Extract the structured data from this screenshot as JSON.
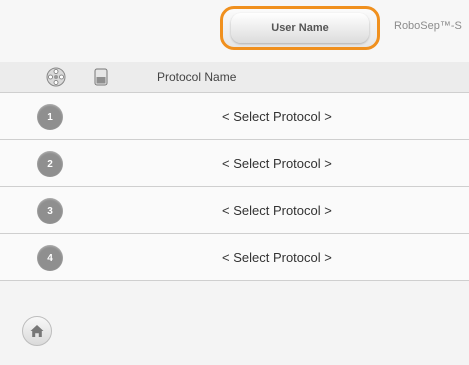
{
  "header": {
    "user_button_label": "User Name",
    "brand": "RoboSep™-S"
  },
  "table": {
    "column_title": "Protocol Name",
    "rows": [
      {
        "number": "1",
        "label": "< Select Protocol >"
      },
      {
        "number": "2",
        "label": "< Select Protocol >"
      },
      {
        "number": "3",
        "label": "< Select Protocol >"
      },
      {
        "number": "4",
        "label": "< Select Protocol >"
      }
    ]
  },
  "icons": {
    "carousel": "carousel-icon",
    "tube": "tube-icon",
    "home": "home-icon"
  },
  "colors": {
    "highlight": "#f0901e",
    "badge": "#8f8f8f"
  }
}
